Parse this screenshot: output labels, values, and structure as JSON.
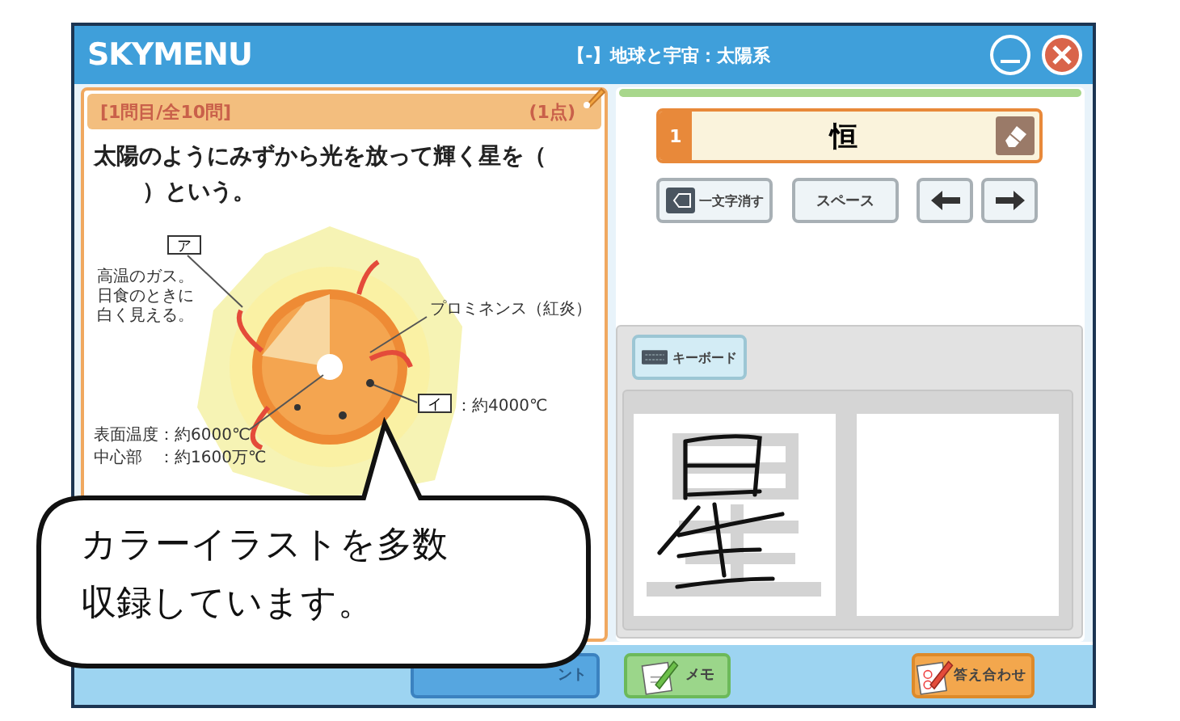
{
  "window": {
    "logo": "SKYMENU",
    "title": "【-】地球と宇宙：太陽系"
  },
  "question": {
    "progress": "[1問目/全10問]",
    "points": "(1点)",
    "lines": [
      "太陽のようにみずから光を放って輝く星を（",
      "）という。"
    ]
  },
  "illustration": {
    "label_a": "ア",
    "gas_note": [
      "高温のガス。",
      "日食のときに",
      "白く見える。"
    ],
    "prominence": "プロミネンス（紅炎）",
    "label_i": "イ",
    "spot_temp": "：約4000℃",
    "surface_temp": "表面温度：約6000℃",
    "core_temp": "中心部　：約1600万℃"
  },
  "answer_progress": {
    "level": 1
  },
  "answer": {
    "number": "1",
    "value": "恒"
  },
  "edit_buttons": [
    {
      "kind": "backspace",
      "label": "一文字消す"
    },
    {
      "kind": "space",
      "label": "スペース"
    },
    {
      "kind": "left"
    },
    {
      "kind": "right"
    }
  ],
  "keyboard_button": "キーボード",
  "footer_buttons": [
    {
      "kind": "hint",
      "label": "ント"
    },
    {
      "kind": "memo",
      "label": "メモ"
    },
    {
      "kind": "check",
      "label": "答え合わせ"
    }
  ],
  "callout": {
    "lines": [
      "カラーイラストを多数",
      "収録しています。"
    ]
  }
}
